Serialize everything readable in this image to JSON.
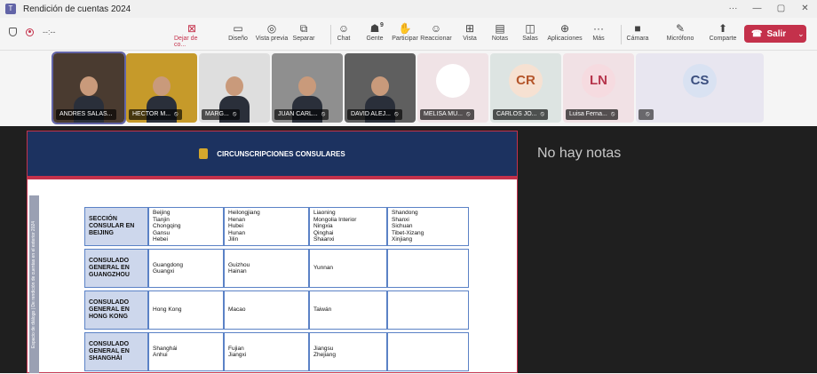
{
  "window": {
    "title": "Rendición de cuentas 2024",
    "controls": [
      "···",
      "—",
      "▢",
      "✕"
    ]
  },
  "toolbar": {
    "timer": "--:--",
    "buttons": [
      {
        "label": "Dejar de co...",
        "icon": "stop-share-icon",
        "glyph": "⊠"
      },
      {
        "label": "Diseño",
        "icon": "layout-icon",
        "glyph": "▭"
      },
      {
        "label": "Vista previa",
        "icon": "preview-icon",
        "glyph": "◎"
      },
      {
        "label": "Separar",
        "icon": "popout-icon",
        "glyph": "⧉"
      },
      {
        "label": "Chat",
        "icon": "chat-icon",
        "glyph": "☺"
      },
      {
        "label": "Gente",
        "icon": "people-icon",
        "glyph": "☗",
        "count": "9"
      },
      {
        "label": "Participar",
        "icon": "raise-hand-icon",
        "glyph": "✋"
      },
      {
        "label": "Reaccionar",
        "icon": "react-icon",
        "glyph": "☺"
      },
      {
        "label": "Vista",
        "icon": "view-icon",
        "glyph": "⊞"
      },
      {
        "label": "Notas",
        "icon": "notes-icon",
        "glyph": "▤"
      },
      {
        "label": "Salas",
        "icon": "rooms-icon",
        "glyph": "◫"
      },
      {
        "label": "Aplicaciones",
        "icon": "apps-icon",
        "glyph": "⊕"
      },
      {
        "label": "Más",
        "icon": "more-icon",
        "glyph": "···"
      },
      {
        "label": "Cámara",
        "icon": "camera-off-icon",
        "glyph": "■"
      },
      {
        "label": "Micrófono",
        "icon": "mic-off-icon",
        "glyph": "✎"
      },
      {
        "label": "Comparte",
        "icon": "share-icon",
        "glyph": "⬆"
      }
    ],
    "leave": {
      "label": "Salir",
      "icon": "hangup-icon"
    }
  },
  "participants": [
    {
      "name": "ANDRES SALAS...",
      "type": "video",
      "bg": "#4a3b30",
      "muted": false
    },
    {
      "name": "HECTOR M...",
      "type": "video",
      "bg": "#c69a2a",
      "muted": true
    },
    {
      "name": "MARG...",
      "type": "video",
      "bg": "#dedede",
      "muted": true
    },
    {
      "name": "JUAN CARL...",
      "type": "video",
      "bg": "#8f8f8f",
      "muted": true
    },
    {
      "name": "DAVID ALEJ...",
      "type": "video",
      "bg": "#5f5f5f",
      "muted": true
    },
    {
      "name": "MELISA MU...",
      "type": "blank",
      "bg": "#f0e3e6",
      "muted": true
    },
    {
      "name": "CARLOS JO...",
      "type": "initials",
      "initials": "CR",
      "bg": "#dde4e2",
      "avatar_bg": "#f6e1d2",
      "avatar_color": "#b4552a",
      "muted": true
    },
    {
      "name": "Luisa Ferna...",
      "type": "initials",
      "initials": "LN",
      "bg": "#f1e1e5",
      "avatar_bg": "#f6dbe0",
      "avatar_color": "#b6354c",
      "muted": true
    },
    {
      "name": "",
      "type": "initials",
      "initials": "CS",
      "bg": "#e8e6f0",
      "avatar_bg": "#d9e2f2",
      "avatar_color": "#3a4e7e",
      "muted": true
    }
  ],
  "slide": {
    "title": "CIRCUNSCRIPCIONES CONSULARES",
    "side_text": "Espacio de diálogo | De rendición de cuentas en el exterior 2024",
    "rows": [
      {
        "header": "SECCIÓN CONSULAR EN BEIJING",
        "cols": [
          "Beijing\nTianjin\nChongqing\nGansu\nHebei",
          "Heilongjiang\nHenan\nHubei\nHunan\nJilin",
          "Liaoning\nMongolia Interior\nNingxia\nQinghai\nShaanxi",
          "Shandong\nShanxi\nSichuan\nTibet-Xizang\nXinjiang"
        ]
      },
      {
        "header": "CONSULADO GENERAL EN GUANGZHOU",
        "cols": [
          "Guangdong\nGuangxi",
          "Guizhou\nHainan",
          "Yunnan",
          ""
        ]
      },
      {
        "header": "CONSULADO GENERAL EN HONG KONG",
        "cols": [
          "Hong Kong",
          "Macao",
          "Taiwán",
          ""
        ]
      },
      {
        "header": "CONSULADO GENERAL EN SHANGHÁI",
        "cols": [
          "Shanghái\nAnhui",
          "Fujian\nJiangxi",
          "Jiangsu\nZhejiang",
          ""
        ]
      }
    ]
  },
  "notes_panel": {
    "text": "No hay notas"
  }
}
